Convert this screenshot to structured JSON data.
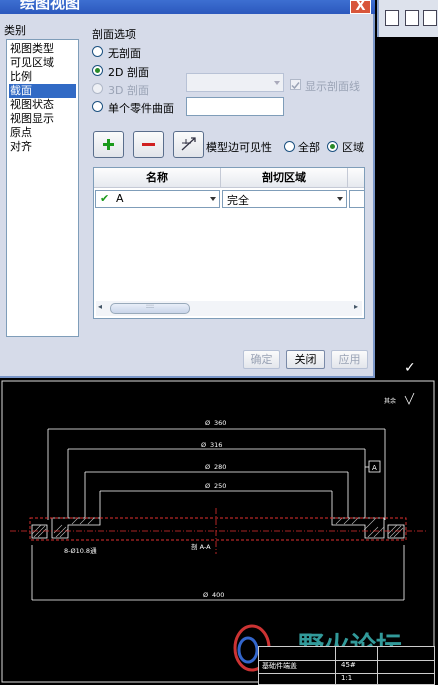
{
  "window": {
    "title": "绘图视图",
    "close_glyph": "X"
  },
  "categories": {
    "header": "类别",
    "items": [
      "视图类型",
      "可见区域",
      "比例",
      "截面",
      "视图状态",
      "视图显示",
      "原点",
      "对齐"
    ],
    "selected": "截面"
  },
  "section": {
    "header": "剖面选项",
    "options": [
      {
        "label": "无剖面",
        "checked": false,
        "enabled": true
      },
      {
        "label": "2D 剖面",
        "checked": true,
        "enabled": true
      },
      {
        "label": "3D 剖面",
        "checked": false,
        "enabled": false
      },
      {
        "label": "单个零件曲面",
        "checked": false,
        "enabled": true
      }
    ],
    "show_section_lines": "显示剖面线"
  },
  "toolbar": {
    "add_glyph": "+",
    "remove_glyph": "−",
    "edge_glyph": "⤢",
    "edge_visibility_label": "模型边可见性",
    "scope_all": "全部",
    "scope_area": "区域",
    "scope_selected": "区域"
  },
  "table": {
    "columns": [
      "名称",
      "剖切区域"
    ],
    "rows": [
      {
        "check": "✔",
        "name": "A",
        "area": "完全"
      }
    ],
    "scroll_grip": "::::"
  },
  "buttons": {
    "ok": "确定",
    "close": "关闭",
    "apply": "应用"
  },
  "drawing": {
    "dims": [
      "360",
      "316",
      "280",
      "250",
      "400"
    ],
    "phi": "Ø",
    "datum_label": "A",
    "hole_note": "8-Ø10.8通",
    "section_note": "剖 A-A",
    "roughness_note": "其余",
    "check_glyph": "✓"
  },
  "watermark": {
    "text": "野火论坛"
  },
  "title_block": {
    "material": "45#",
    "scale": "1:1",
    "drawing_title": "基础件端盖"
  },
  "colors": {
    "titlebar": "#2b58bd",
    "dialog_bg": "#d6dbe9",
    "selection": "#316ac5",
    "add_green": "#1a9a1a",
    "remove_red": "#d02020",
    "cad_red": "#e03030",
    "cad_bg": "#000000"
  }
}
